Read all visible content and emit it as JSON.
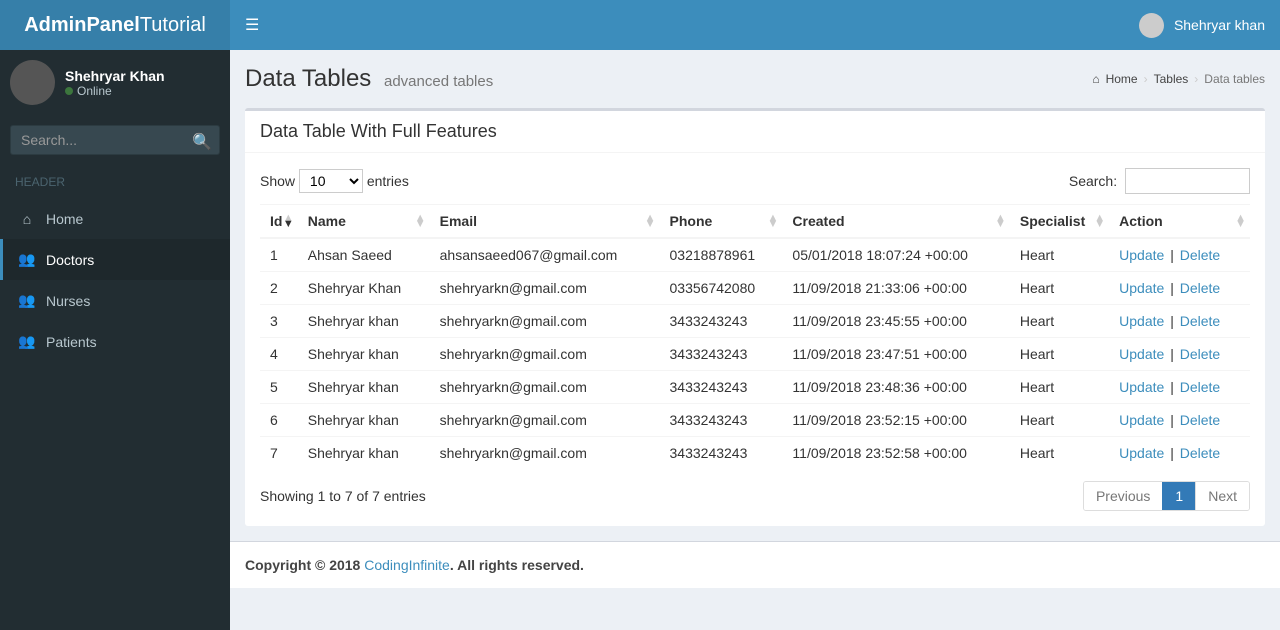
{
  "logo": {
    "bold": "AdminPanel",
    "light": "Tutorial"
  },
  "navbar": {
    "user": "Shehryar khan"
  },
  "sidebar": {
    "user": {
      "name": "Shehryar Khan",
      "status": "Online"
    },
    "search_placeholder": "Search...",
    "header_label": "HEADER",
    "items": [
      {
        "label": "Home",
        "icon": "⌂"
      },
      {
        "label": "Doctors",
        "icon": "👥"
      },
      {
        "label": "Nurses",
        "icon": "👥"
      },
      {
        "label": "Patients",
        "icon": "👥"
      }
    ]
  },
  "page": {
    "title": "Data Tables",
    "subtitle": "advanced tables",
    "breadcrumb": {
      "home": "Home",
      "tables": "Tables",
      "current": "Data tables"
    }
  },
  "box": {
    "title": "Data Table With Full Features"
  },
  "datatable": {
    "length": {
      "prefix": "Show",
      "value": "10",
      "suffix": "entries"
    },
    "filter": {
      "label": "Search:"
    },
    "columns": [
      "Id",
      "Name",
      "Email",
      "Phone",
      "Created",
      "Specialist",
      "Action"
    ],
    "rows": [
      {
        "id": "1",
        "name": "Ahsan Saeed",
        "email": "ahsansaeed067@gmail.com",
        "phone": "03218878961",
        "created": "05/01/2018 18:07:24 +00:00",
        "specialist": "Heart"
      },
      {
        "id": "2",
        "name": "Shehryar Khan",
        "email": "shehryarkn@gmail.com",
        "phone": "03356742080",
        "created": "11/09/2018 21:33:06 +00:00",
        "specialist": "Heart"
      },
      {
        "id": "3",
        "name": "Shehryar khan",
        "email": "shehryarkn@gmail.com",
        "phone": "3433243243",
        "created": "11/09/2018 23:45:55 +00:00",
        "specialist": "Heart"
      },
      {
        "id": "4",
        "name": "Shehryar khan",
        "email": "shehryarkn@gmail.com",
        "phone": "3433243243",
        "created": "11/09/2018 23:47:51 +00:00",
        "specialist": "Heart"
      },
      {
        "id": "5",
        "name": "Shehryar khan",
        "email": "shehryarkn@gmail.com",
        "phone": "3433243243",
        "created": "11/09/2018 23:48:36 +00:00",
        "specialist": "Heart"
      },
      {
        "id": "6",
        "name": "Shehryar khan",
        "email": "shehryarkn@gmail.com",
        "phone": "3433243243",
        "created": "11/09/2018 23:52:15 +00:00",
        "specialist": "Heart"
      },
      {
        "id": "7",
        "name": "Shehryar khan",
        "email": "shehryarkn@gmail.com",
        "phone": "3433243243",
        "created": "11/09/2018 23:52:58 +00:00",
        "specialist": "Heart"
      }
    ],
    "actions": {
      "update": "Update",
      "delete": "Delete"
    },
    "info": "Showing 1 to 7 of 7 entries",
    "pagination": {
      "prev": "Previous",
      "pages": [
        "1"
      ],
      "next": "Next",
      "current": "1"
    }
  },
  "footer": {
    "prefix": "Copyright © 2018 ",
    "link": "CodingInfinite",
    "suffix": ". All rights reserved."
  }
}
